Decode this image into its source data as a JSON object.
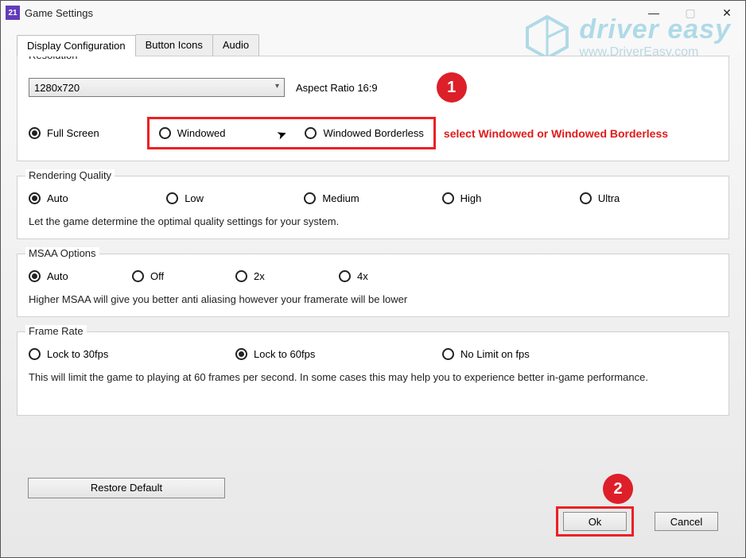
{
  "window": {
    "app_icon_text": "21",
    "title": "Game Settings"
  },
  "tabs": {
    "display": "Display Configuration",
    "buttons": "Button Icons",
    "audio": "Audio"
  },
  "resolution": {
    "legend": "Resolution",
    "selected": "1280x720",
    "aspect": "Aspect Ratio 16:9",
    "modes": {
      "fullscreen": "Full Screen",
      "windowed": "Windowed",
      "windowed_borderless": "Windowed Borderless"
    }
  },
  "rendering": {
    "legend": "Rendering Quality",
    "options": {
      "auto": "Auto",
      "low": "Low",
      "medium": "Medium",
      "high": "High",
      "ultra": "Ultra"
    },
    "help": "Let the game determine the optimal quality settings for your system."
  },
  "msaa": {
    "legend": "MSAA Options",
    "options": {
      "auto": "Auto",
      "off": "Off",
      "x2": "2x",
      "x4": "4x"
    },
    "help": "Higher MSAA will give you better anti aliasing however your framerate will be lower"
  },
  "framerate": {
    "legend": "Frame Rate",
    "options": {
      "l30": "Lock  to 30fps",
      "l60": "Lock to 60fps",
      "nolimit": "No Limit on fps"
    },
    "help": "This will limit the game to playing at 60 frames per second. In some cases this may help you to experience better in-game performance."
  },
  "buttons": {
    "restore": "Restore Default",
    "ok": "Ok",
    "cancel": "Cancel"
  },
  "annotations": {
    "step1": "1",
    "step1_text": "select Windowed or Windowed Borderless",
    "step2": "2"
  },
  "watermark": {
    "brand": "driver easy",
    "url": "www.DriverEasy.com"
  }
}
